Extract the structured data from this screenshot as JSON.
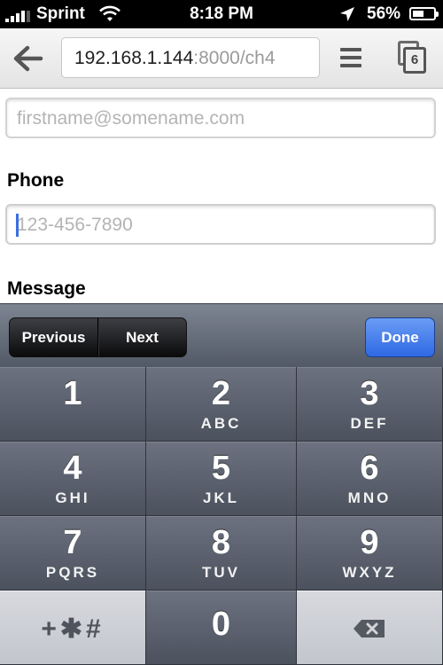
{
  "status_bar": {
    "carrier": "Sprint",
    "time": "8:18 PM",
    "battery_percent": "56%",
    "battery_level": 0.56,
    "icons": [
      "signal-bars-icon",
      "wifi-icon",
      "location-arrow-icon",
      "battery-icon"
    ]
  },
  "browser": {
    "url_host": "192.168.1.144",
    "url_path": ":8000/ch4",
    "tab_count": "6",
    "icons": [
      "back-arrow-icon",
      "menu-icon",
      "tabs-icon"
    ]
  },
  "form": {
    "email_placeholder": "firstname@somename.com",
    "phone_label": "Phone",
    "phone_placeholder": "123-456-7890",
    "message_label": "Message"
  },
  "accessory": {
    "previous": "Previous",
    "next": "Next",
    "done": "Done"
  },
  "keypad": {
    "keys": [
      {
        "digit": "1",
        "letters": ""
      },
      {
        "digit": "2",
        "letters": "ABC"
      },
      {
        "digit": "3",
        "letters": "DEF"
      },
      {
        "digit": "4",
        "letters": "GHI"
      },
      {
        "digit": "5",
        "letters": "JKL"
      },
      {
        "digit": "6",
        "letters": "MNO"
      },
      {
        "digit": "7",
        "letters": "PQRS"
      },
      {
        "digit": "8",
        "letters": "TUV"
      },
      {
        "digit": "9",
        "letters": "WXYZ"
      },
      {
        "digit": "0",
        "letters": ""
      }
    ],
    "symbols": "+✱#",
    "icons": [
      "delete-backspace-icon"
    ]
  },
  "colors": {
    "accent_blue": "#2f68e3",
    "keypad_dark": "#4b515d",
    "keypad_light": "#c3c6cd"
  }
}
